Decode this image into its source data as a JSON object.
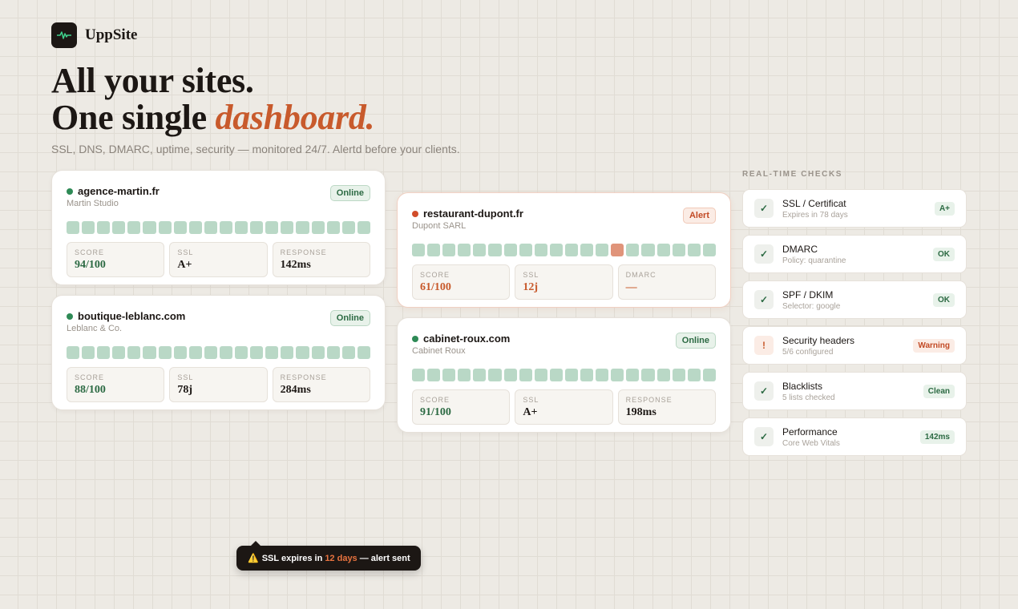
{
  "brand": {
    "name": "UppSite"
  },
  "hero": {
    "line1": "All your sites.",
    "line2_prefix": "One single ",
    "line2_accent": "dashboard.",
    "subtitle": "SSL, DNS, DMARC, uptime, security — monitored 24/7. Alertd before your clients."
  },
  "colors": {
    "accent": "#c85a2c",
    "ok": "#2e8a56",
    "alert": "#d14d2a",
    "dark": "#1c1714"
  },
  "sites": [
    {
      "name": "agence-martin.fr",
      "owner": "Martin Studio",
      "status": "Online",
      "status_type": "ok",
      "uptime_down_index": [],
      "stats": [
        {
          "label": "SCORE",
          "value": "94/100",
          "tone": "green"
        },
        {
          "label": "SSL",
          "value": "A+",
          "tone": ""
        },
        {
          "label": "RESPONSE",
          "value": "142ms",
          "tone": ""
        }
      ]
    },
    {
      "name": "boutique-leblanc.com",
      "owner": "Leblanc & Co.",
      "status": "Online",
      "status_type": "ok",
      "uptime_down_index": [],
      "stats": [
        {
          "label": "SCORE",
          "value": "88/100",
          "tone": "green"
        },
        {
          "label": "SSL",
          "value": "78j",
          "tone": ""
        },
        {
          "label": "RESPONSE",
          "value": "284ms",
          "tone": ""
        }
      ]
    },
    {
      "name": "restaurant-dupont.fr",
      "owner": "Dupont SARL",
      "status": "Alert",
      "status_type": "bad",
      "uptime_down_index": [
        13
      ],
      "stats": [
        {
          "label": "SCORE",
          "value": "61/100",
          "tone": "orange"
        },
        {
          "label": "SSL",
          "value": "12j",
          "tone": "orange"
        },
        {
          "label": "DMARC",
          "value": "—",
          "tone": "orange"
        }
      ]
    },
    {
      "name": "cabinet-roux.com",
      "owner": "Cabinet Roux",
      "status": "Online",
      "status_type": "ok",
      "uptime_down_index": [],
      "stats": [
        {
          "label": "SCORE",
          "value": "91/100",
          "tone": "green"
        },
        {
          "label": "SSL",
          "value": "A+",
          "tone": ""
        },
        {
          "label": "RESPONSE",
          "value": "198ms",
          "tone": ""
        }
      ]
    }
  ],
  "checks": {
    "title": "REAL-TIME CHECKS",
    "items": [
      {
        "name": "SSL / Certificat",
        "desc": "Expires in 78 days",
        "badge": "A+",
        "icon": "check-icon",
        "tone": "ok"
      },
      {
        "name": "DMARC",
        "desc": "Policy: quarantine",
        "badge": "OK",
        "icon": "check-icon",
        "tone": "ok"
      },
      {
        "name": "SPF / DKIM",
        "desc": "Selector: google",
        "badge": "OK",
        "icon": "check-icon",
        "tone": "ok"
      },
      {
        "name": "Security headers",
        "desc": "5/6 configured",
        "badge": "Warning",
        "icon": "exclamation-icon",
        "tone": "warn"
      },
      {
        "name": "Blacklists",
        "desc": "5 lists checked",
        "badge": "Clean",
        "icon": "check-icon",
        "tone": "ok"
      },
      {
        "name": "Performance",
        "desc": "Core Web Vitals",
        "badge": "142ms",
        "icon": "check-icon",
        "tone": "ok"
      }
    ]
  },
  "toast": {
    "prefix": "SSL expires in",
    "highlight": "12 days",
    "suffix": "— alert sent",
    "icon": "warning-icon"
  }
}
